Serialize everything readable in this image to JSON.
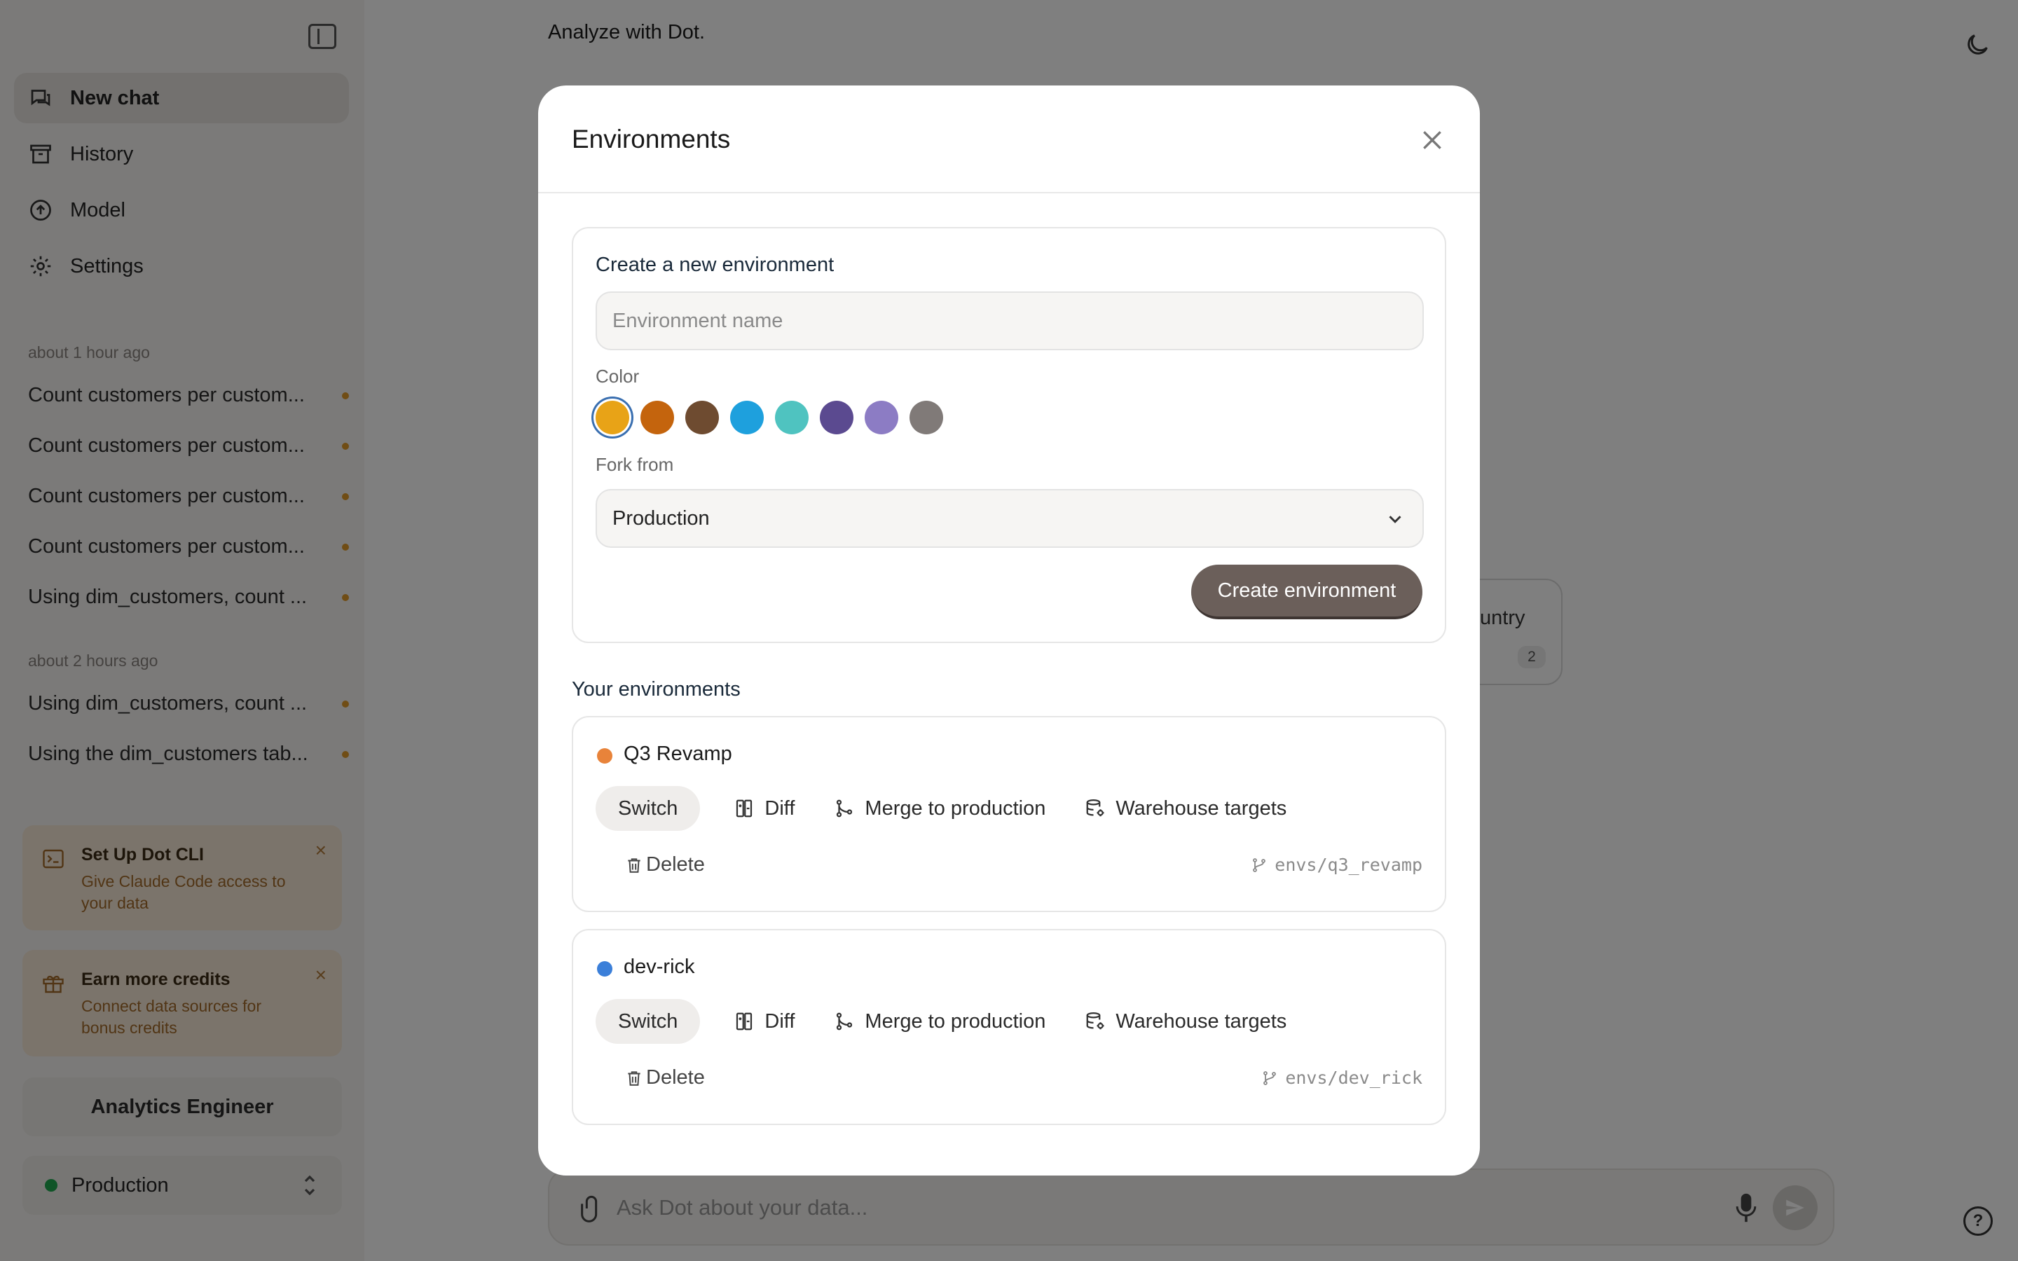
{
  "sidebar": {
    "nav": [
      {
        "label": "New chat",
        "icon": "chat-icon"
      },
      {
        "label": "History",
        "icon": "archive-icon"
      },
      {
        "label": "Model",
        "icon": "upload-circle-icon"
      },
      {
        "label": "Settings",
        "icon": "gear-icon"
      }
    ],
    "groups": [
      {
        "label": "about 1 hour ago",
        "items": [
          "Count customers per custom...",
          "Count customers per custom...",
          "Count customers per custom...",
          "Count customers per custom...",
          "Using dim_customers, count ..."
        ]
      },
      {
        "label": "about 2 hours ago",
        "items": [
          "Using dim_customers, count ...",
          "Using the dim_customers tab..."
        ]
      }
    ],
    "promos": [
      {
        "title": "Set Up Dot CLI",
        "desc_line1": "Give Claude Code access to",
        "desc_line2": "your data",
        "icon": "terminal-icon"
      },
      {
        "title": "Earn more credits",
        "desc_line1": "Connect data sources for",
        "desc_line2": "bonus credits",
        "icon": "gift-icon"
      }
    ],
    "role": "Analytics Engineer",
    "environment": {
      "label": "Production",
      "color": "#1fa84f"
    }
  },
  "main": {
    "title": "Analyze with Dot.",
    "chip": {
      "text": "untry",
      "count": "2"
    },
    "input_placeholder": "Ask Dot about your data..."
  },
  "modal": {
    "title": "Environments",
    "create": {
      "heading": "Create a new environment",
      "name_placeholder": "Environment name",
      "color_label": "Color",
      "colors": [
        "#e8a317",
        "#c4640d",
        "#6e4b30",
        "#1ea0dd",
        "#4fc3c0",
        "#5b4a90",
        "#8c7cc4",
        "#807a78"
      ],
      "selected_color": "#e8a317",
      "fork_label": "Fork from",
      "fork_value": "Production",
      "button": "Create environment"
    },
    "list_heading": "Your environments",
    "environments": [
      {
        "name": "Q3 Revamp",
        "color": "#e8833a",
        "branch": "envs/q3_revamp"
      },
      {
        "name": "dev-rick",
        "color": "#3b7fd9",
        "branch": "envs/dev_rick"
      }
    ],
    "actions": {
      "switch": "Switch",
      "diff": "Diff",
      "merge": "Merge to production",
      "warehouse": "Warehouse targets",
      "delete": "Delete"
    }
  }
}
